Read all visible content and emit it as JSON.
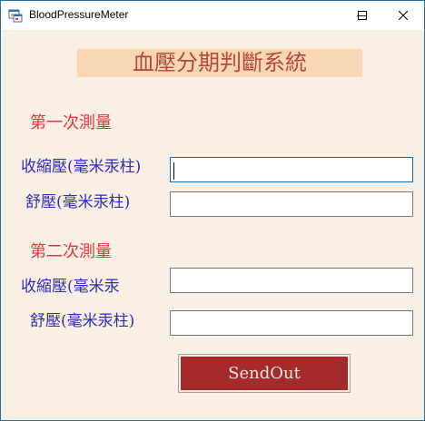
{
  "window": {
    "title": "BloodPressureMeter",
    "icon": "app-window-icon",
    "controls": {
      "minimize": "minimize-icon",
      "maximize": "maximize-icon",
      "close": "close-icon"
    }
  },
  "header": {
    "title": "血壓分期判斷系統"
  },
  "first": {
    "section": "第一次測量",
    "systolic_label": "收縮壓(毫米汞柱)",
    "diastolic_label": "舒壓(毫米汞柱)",
    "systolic_value": "",
    "diastolic_value": ""
  },
  "second": {
    "section": "第二次測量",
    "systolic_label": "收縮壓(毫米汞",
    "diastolic_label": "舒壓(毫米汞柱)",
    "systolic_value": "",
    "diastolic_value": ""
  },
  "send_label": "SendOut",
  "colors": {
    "form_background": "#faefe5",
    "header_background": "#fad7b4",
    "header_text": "#b24a3c",
    "section_text": "#e8343a",
    "label_text": "#2d2db8",
    "button_background": "#a52a2a",
    "focus_border": "#0f6fc6"
  }
}
